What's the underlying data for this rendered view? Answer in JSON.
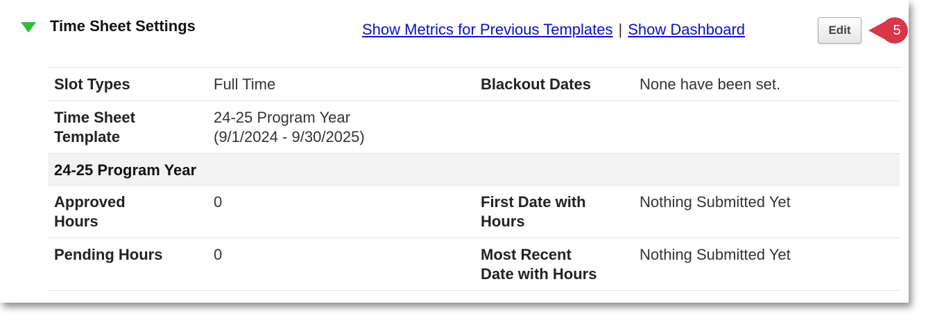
{
  "header": {
    "title": "Time Sheet Settings",
    "show_metrics_link": "Show Metrics for Previous Templates",
    "separator": "|",
    "show_dashboard_link": "Show Dashboard",
    "edit_label": "Edit",
    "callout_number": "5",
    "toggle_color": "#2ebd3a",
    "callout_color": "#d9364b",
    "link_color": "#0a10c8"
  },
  "settings": {
    "slot_types_label": "Slot Types",
    "slot_types_value": "Full Time",
    "blackout_dates_label": "Blackout Dates",
    "blackout_dates_value": "None have been set.",
    "template_label_line1": "Time Sheet",
    "template_label_line2": "Template",
    "template_value_line1": "24-25 Program Year",
    "template_value_line2": "(9/1/2024 - 9/30/2025)"
  },
  "program_year": {
    "heading": "24-25 Program Year",
    "approved_hours_label_line1": "Approved",
    "approved_hours_label_line2": "Hours",
    "approved_hours_value": "0",
    "first_date_label_line1": "First Date with",
    "first_date_label_line2": "Hours",
    "first_date_value": "Nothing Submitted Yet",
    "pending_hours_label": "Pending Hours",
    "pending_hours_value": "0",
    "recent_date_label_line1": "Most Recent",
    "recent_date_label_line2": "Date with Hours",
    "recent_date_value": "Nothing Submitted Yet"
  }
}
